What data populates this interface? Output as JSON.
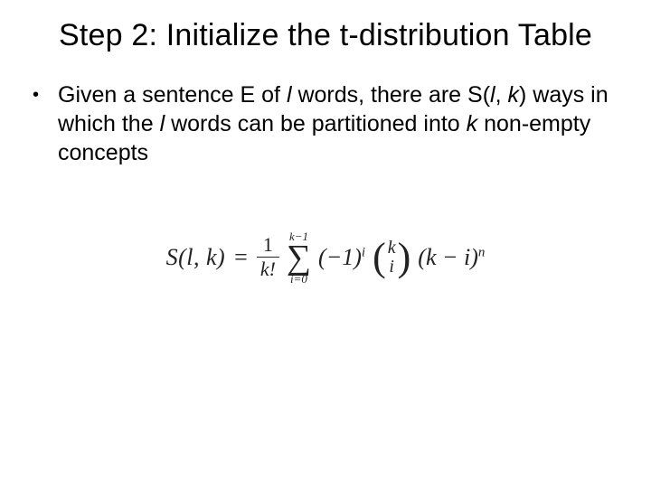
{
  "title": "Step 2: Initialize the t-distribution Table",
  "bullet": {
    "part1": "Given a sentence E of ",
    "l1": "l",
    "part2": " words, there are S(",
    "l2": "l",
    "comma": ", ",
    "k1": "k",
    "part3": ") ways in which the ",
    "l3": "l",
    "part4": " words can be partitioned into ",
    "k2": "k",
    "part5": " non-empty concepts"
  },
  "formula": {
    "lhs": "S(l, k)",
    "eq": "=",
    "frac_num": "1",
    "frac_den": "k!",
    "sum_top": "k−1",
    "sigma": "∑",
    "sum_bot": "i=0",
    "neg1i_a": "(−1)",
    "neg1i_b": "i",
    "binom_top": "k",
    "binom_bot": "i",
    "tail_a": "(k − i)",
    "tail_b": "n"
  }
}
